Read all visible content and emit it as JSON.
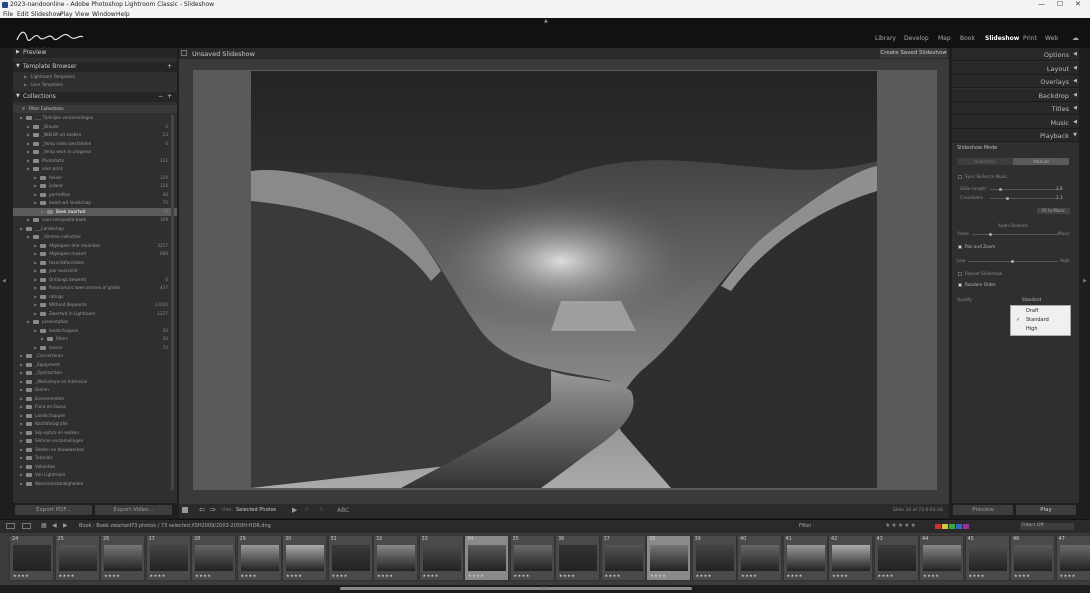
{
  "window": {
    "title": "2023-nandoonline - Adobe Photoshop Lightroom Classic - Slideshow"
  },
  "menu": [
    "File",
    "Edit",
    "Slideshow",
    "Play",
    "View",
    "Window",
    "Help"
  ],
  "modules": [
    "Library",
    "Develop",
    "Map",
    "Book",
    "Slideshow",
    "Print",
    "Web"
  ],
  "left": {
    "preview": "Preview",
    "template_browser": "Template Browser",
    "templates": [
      "Lightroom Templates",
      "User Templates"
    ],
    "collections": "Collections",
    "filter": "Filter Collections",
    "rows": [
      {
        "label": "___ Tijdelijke verzamelingen",
        "count": "",
        "indent": 1
      },
      {
        "label": "_Brouze",
        "count": "2",
        "indent": 2
      },
      {
        "label": "_NIEUW uit zoeken",
        "count": "23",
        "indent": 2
      },
      {
        "label": "_temp video bestanden",
        "count": "0",
        "indent": 2
      },
      {
        "label": "_temp work in progress",
        "count": "",
        "indent": 2
      },
      {
        "label": "Photofacts",
        "count": "121",
        "indent": 2
      },
      {
        "label": "voor print",
        "count": "",
        "indent": 2
      },
      {
        "label": "feeser",
        "count": "124",
        "indent": 3
      },
      {
        "label": "ijsland",
        "count": "124",
        "indent": 3
      },
      {
        "label": "portretten",
        "count": "46",
        "indent": 3
      },
      {
        "label": "zwart-wit landschap",
        "count": "75",
        "indent": 3
      },
      {
        "label": "Boek zwartwit",
        "count": "73",
        "indent": 4
      },
      {
        "label": "voor-composite-boek",
        "count": "109",
        "indent": 2
      },
      {
        "label": "___Landschap",
        "count": "",
        "indent": 1
      },
      {
        "label": "_Slimme collecties",
        "count": "",
        "indent": 2
      },
      {
        "label": "Afgelopen drie maanden",
        "count": "3217",
        "indent": 3
      },
      {
        "label": "Afgelopen maand",
        "count": "869",
        "indent": 3
      },
      {
        "label": "favorietformaten",
        "count": "",
        "indent": 3
      },
      {
        "label": "jaar overzicht",
        "count": "",
        "indent": 3
      },
      {
        "label": "Ontlangs bewerkt",
        "count": "6",
        "indent": 3
      },
      {
        "label": "Panorama's twee sterren of groter",
        "count": "437",
        "indent": 3
      },
      {
        "label": "ratings",
        "count": "",
        "indent": 3
      },
      {
        "label": "Without Keywords",
        "count": "12200",
        "indent": 3
      },
      {
        "label": "Zwartwit in Lightroom",
        "count": "1227",
        "indent": 3
      },
      {
        "label": "presentaties",
        "count": "",
        "indent": 2
      },
      {
        "label": "landschappen",
        "count": "50",
        "indent": 3
      },
      {
        "label": "filters",
        "count": "50",
        "indent": 4
      },
      {
        "label": "macro",
        "count": "74",
        "indent": 3
      },
      {
        "label": "_Converteren",
        "count": "",
        "indent": 1
      },
      {
        "label": "_Equipment",
        "count": "",
        "indent": 1
      },
      {
        "label": "_Opdrachten",
        "count": "",
        "indent": 1
      },
      {
        "label": "_Workshops en Intervisie",
        "count": "",
        "indent": 1
      },
      {
        "label": "Dieren",
        "count": "",
        "indent": 1
      },
      {
        "label": "Evenementen",
        "count": "",
        "indent": 1
      },
      {
        "label": "Flora en Fauna",
        "count": "",
        "indent": 1
      },
      {
        "label": "Landschappen",
        "count": "",
        "indent": 1
      },
      {
        "label": "Nachtfotografie",
        "count": "",
        "indent": 1
      },
      {
        "label": "Sky-optics en wolken",
        "count": "",
        "indent": 1
      },
      {
        "label": "Slimme verzamelingen",
        "count": "",
        "indent": 1
      },
      {
        "label": "Steden en bouwwerken",
        "count": "",
        "indent": 1
      },
      {
        "label": "Tutorials",
        "count": "",
        "indent": 1
      },
      {
        "label": "Vakanties",
        "count": "",
        "indent": 1
      },
      {
        "label": "Van Lightroom",
        "count": "",
        "indent": 1
      },
      {
        "label": "Weersomstandigheden",
        "count": "",
        "indent": 1
      }
    ],
    "export_pdf": "Export PDF...",
    "export_video": "Export Video..."
  },
  "center": {
    "title": "Unsaved Slideshow",
    "create_saved": "Create Saved Slideshow",
    "use_label": "Use:",
    "use_value": "Selected Photos",
    "abc": "ABC",
    "slide_info": "Slide 34 of 73  0:03:34"
  },
  "right": {
    "panels": [
      "Options",
      "Layout",
      "Overlays",
      "Backdrop",
      "Titles",
      "Music",
      "Playback"
    ],
    "slideshow_mode": "Slideshow Mode",
    "mode_auto": "Automatic",
    "mode_manual": "Manual",
    "sync": "Sync Slides to Music",
    "slide_length": "Slide Length",
    "crossfades": "Crossfades",
    "slide_len_val": "3.8",
    "cross_val": "1.3",
    "fit_music": "Fit to Music",
    "audio_balance": "Audio Balance",
    "video": "Video",
    "music": "Music",
    "pan_zoom": "Pan and Zoom",
    "low": "Low",
    "high_lbl": "High",
    "repeat": "Repeat Slideshow",
    "random": "Random Order",
    "quality": "Quality",
    "quality_value": "Standard",
    "dropdown": [
      "Draft",
      "Standard",
      "High"
    ],
    "preview": "Preview",
    "play": "Play"
  },
  "filmbar": {
    "info": "Book : Boek zwartwit",
    "selected": "73 photos / 73 selected /ISH2009/2003-2050H-HDR.dng",
    "filter": "Filter :",
    "filters_off": "Filters Off"
  },
  "filmstrip": [
    {
      "num": "24"
    },
    {
      "num": "25"
    },
    {
      "num": "26"
    },
    {
      "num": "27"
    },
    {
      "num": "28"
    },
    {
      "num": "29"
    },
    {
      "num": "30"
    },
    {
      "num": "31"
    },
    {
      "num": "32"
    },
    {
      "num": "33"
    },
    {
      "num": "34"
    },
    {
      "num": "35"
    },
    {
      "num": "36"
    },
    {
      "num": "37"
    },
    {
      "num": "38"
    },
    {
      "num": "39"
    },
    {
      "num": "40"
    },
    {
      "num": "41"
    },
    {
      "num": "42"
    },
    {
      "num": "43"
    },
    {
      "num": "44"
    },
    {
      "num": "45"
    },
    {
      "num": "46"
    },
    {
      "num": "47"
    }
  ],
  "stars": "★★★★"
}
